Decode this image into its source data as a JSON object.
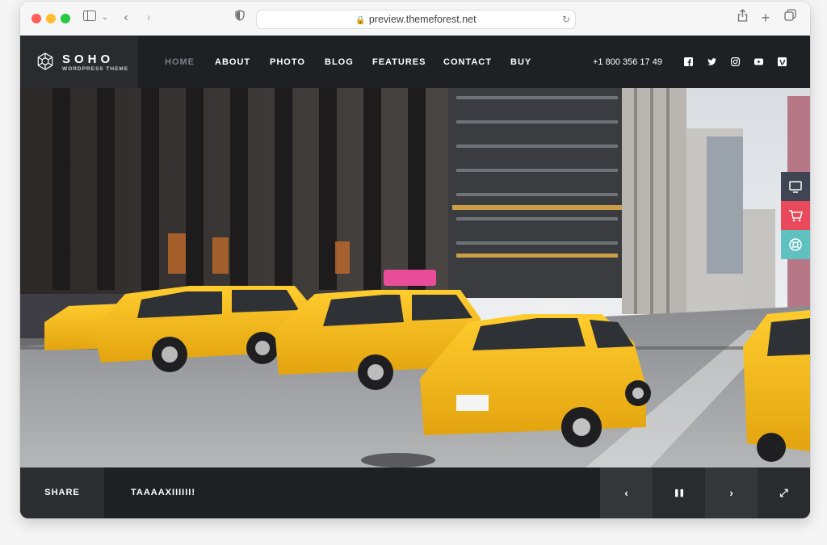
{
  "browser": {
    "url": "preview.themeforest.net"
  },
  "brand": {
    "title": "SOHO",
    "subtitle": "WORDPRESS THEME"
  },
  "nav": {
    "items": [
      {
        "label": "HOME",
        "active": true
      },
      {
        "label": "ABOUT"
      },
      {
        "label": "PHOTO"
      },
      {
        "label": "BLOG"
      },
      {
        "label": "FEATURES"
      },
      {
        "label": "CONTACT"
      },
      {
        "label": "BUY"
      }
    ],
    "phone": "+1 800 356 17 49",
    "social_icons": [
      "facebook-icon",
      "twitter-icon",
      "instagram-icon",
      "youtube-icon",
      "vimeo-icon"
    ]
  },
  "side_widgets": {
    "icons": [
      "monitor-icon",
      "cart-icon",
      "support-icon"
    ],
    "colors": [
      "#3f4552",
      "#e94a5b",
      "#5fc2c0"
    ]
  },
  "footer_bar": {
    "share_label": "SHARE",
    "caption": "TAAAAXIIIIII!",
    "controls": {
      "prev": "‹",
      "pause": "❚❚",
      "next": "›",
      "fullscreen": "⤢"
    }
  },
  "colors": {
    "header_bg": "#1f2024",
    "nav_active": "#7d7f85",
    "taxi_yellow": "#f4b81c"
  }
}
